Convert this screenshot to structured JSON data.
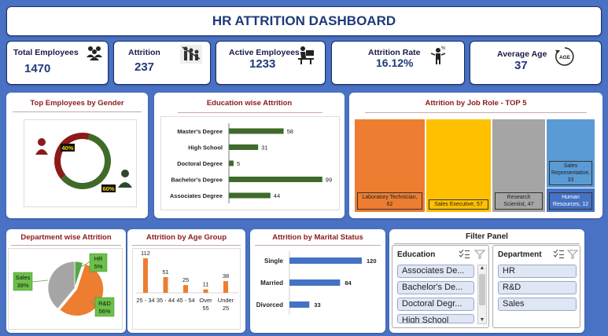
{
  "dashboard": {
    "title": "HR ATTRITION DASHBOARD"
  },
  "kpis": [
    {
      "label": "Total Employees",
      "value": "1470",
      "icon": "people-group-icon"
    },
    {
      "label": "Attrition",
      "value": "237",
      "icon": "people-leaving-icon"
    },
    {
      "label": "Active Employees",
      "value": "1233",
      "icon": "desk-worker-icon"
    },
    {
      "label": "Attrition Rate",
      "value": "16.12%",
      "icon": "percent-person-icon"
    },
    {
      "label": "Average Age",
      "value": "37",
      "icon": "age-icon"
    }
  ],
  "age_icon_text": "AGE",
  "gender": {
    "title": "Top Employees by Gender",
    "female_pct": "40%",
    "male_pct": "60%"
  },
  "education_chart": {
    "title": "Education wise Attrition"
  },
  "jobrole": {
    "title": "Attrition by Job Role - TOP 5"
  },
  "department": {
    "title": "Department wise Attrition",
    "labels": [
      {
        "name": "HR",
        "pct": "5%"
      },
      {
        "name": "Sales",
        "pct": "39%"
      },
      {
        "name": "R&D",
        "pct": "56%"
      }
    ]
  },
  "agegroup": {
    "title": "Attrition by Age Group"
  },
  "marital": {
    "title": "Attrition by Marital Status"
  },
  "filter": {
    "title": "Filter Panel",
    "education_header": "Education",
    "education_items": [
      "Associates De...",
      "Bachelor's De...",
      "Doctoral Degr...",
      "High School"
    ],
    "department_header": "Department",
    "department_items": [
      "HR",
      "R&D",
      "Sales"
    ]
  },
  "chart_data": [
    {
      "type": "pie",
      "chart": "gender-donut",
      "categories": [
        "Female",
        "Male"
      ],
      "values": [
        40,
        60
      ],
      "colors": [
        "#8b1a1a",
        "#3f6b2a"
      ]
    },
    {
      "type": "bar",
      "chart": "education",
      "orientation": "horizontal",
      "categories": [
        "Master's Degree",
        "High School",
        "Doctoral Degree",
        "Bachelor's Degree",
        "Associates Degree"
      ],
      "values": [
        58,
        31,
        5,
        99,
        44
      ],
      "color": "#3f6b2a"
    },
    {
      "type": "treemap",
      "chart": "jobrole",
      "categories": [
        "Laboratory Technician",
        "Sales Executive",
        "Research Scientist",
        "Sales Representative",
        "Human Resources"
      ],
      "values": [
        62,
        57,
        47,
        33,
        12
      ],
      "colors": [
        "#ed7d31",
        "#ffc000",
        "#a5a5a5",
        "#5b9bd5",
        "#4472c4"
      ],
      "labels": [
        "Laboratory Technician, 62",
        "Sales Executive, 57",
        "Research Scientist, 47",
        "Sales Representative, 33",
        "Human Resources, 12"
      ]
    },
    {
      "type": "pie",
      "chart": "department",
      "categories": [
        "HR",
        "R&D",
        "Sales"
      ],
      "values": [
        5,
        56,
        39
      ],
      "colors": [
        "#5aa54a",
        "#ed7d31",
        "#a5a5a5"
      ]
    },
    {
      "type": "bar",
      "chart": "agegroup",
      "categories": [
        "25 - 34",
        "35 - 44",
        "45 - 54",
        "Over 55",
        "Under 25"
      ],
      "values": [
        112,
        51,
        25,
        11,
        38
      ],
      "color": "#ed7d31"
    },
    {
      "type": "bar",
      "chart": "marital",
      "orientation": "horizontal",
      "categories": [
        "Single",
        "Married",
        "Divorced"
      ],
      "values": [
        120,
        84,
        33
      ],
      "color": "#4472c4"
    }
  ]
}
